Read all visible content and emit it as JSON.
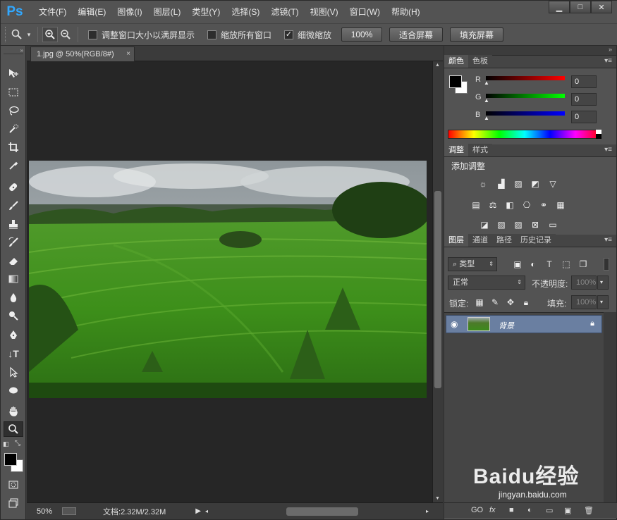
{
  "app": {
    "logo": "Ps",
    "menus": [
      "文件(F)",
      "编辑(E)",
      "图像(I)",
      "图层(L)",
      "类型(Y)",
      "选择(S)",
      "滤镜(T)",
      "视图(V)",
      "窗口(W)",
      "帮助(H)"
    ],
    "window_controls": [
      "▁",
      "□",
      "✕"
    ]
  },
  "options": {
    "resize_windows_label": "调整窗口大小以满屏显示",
    "resize_windows_checked": false,
    "zoom_all_label": "缩放所有窗口",
    "zoom_all_checked": false,
    "scrubby_label": "细微缩放",
    "scrubby_checked": true,
    "btn_100": "100%",
    "btn_fit": "适合屏幕",
    "btn_fill": "填充屏幕"
  },
  "document": {
    "tab_title": "1.jpg @ 50%(RGB/8#)",
    "tab_close": "×",
    "zoom": "50%",
    "doc_size": "文档:2.32M/2.32M"
  },
  "color_panel": {
    "tabs": [
      "颜色",
      "色板"
    ],
    "r_label": "R",
    "r_value": "0",
    "g_label": "G",
    "g_value": "0",
    "b_label": "B",
    "b_value": "0"
  },
  "adjust_panel": {
    "tabs": [
      "调整",
      "样式"
    ],
    "heading": "添加调整"
  },
  "layers_panel": {
    "tabs": [
      "图层",
      "通道",
      "路径",
      "历史记录"
    ],
    "filter_kind": "类型",
    "blend_mode": "正常",
    "opacity_label": "不透明度:",
    "opacity_value": "100%",
    "lock_label": "锁定:",
    "fill_label": "填充:",
    "fill_value": "100%",
    "layer_name": "背景",
    "bottom_icons": [
      "GO",
      "fx",
      "■",
      "◐",
      "▭",
      "▣",
      "🗑"
    ]
  },
  "watermark": {
    "brand": "Baidu经验",
    "url": "jingyan.baidu.com"
  },
  "colors": {
    "accent": "#31a8ff",
    "selected_layer": "#6a7fa1"
  }
}
